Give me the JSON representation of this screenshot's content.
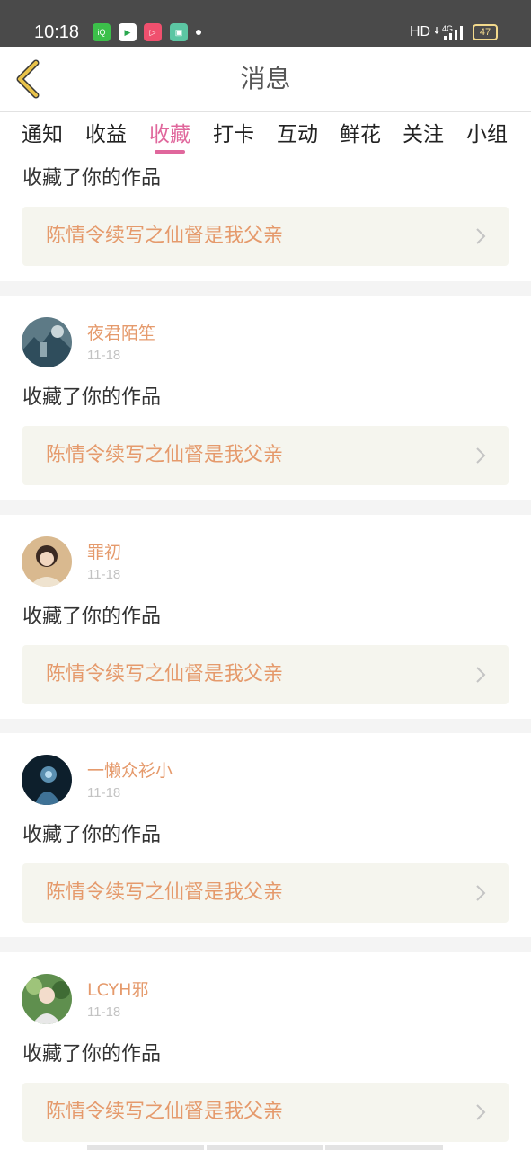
{
  "status_bar": {
    "time": "10:18",
    "network": "HD",
    "signal": "4G",
    "battery": "47"
  },
  "header": {
    "title": "消息",
    "back_icon": "chevron-left-icon"
  },
  "tabs": [
    {
      "label": "通知",
      "active": false
    },
    {
      "label": "收益",
      "active": false
    },
    {
      "label": "收藏",
      "active": true
    },
    {
      "label": "打卡",
      "active": false
    },
    {
      "label": "互动",
      "active": false
    },
    {
      "label": "鲜花",
      "active": false
    },
    {
      "label": "关注",
      "active": false
    },
    {
      "label": "小组",
      "active": false
    }
  ],
  "messages": [
    {
      "user": "",
      "date": "",
      "action": "收藏了你的作品",
      "work_title": "陈情令续写之仙督是我父亲"
    },
    {
      "user": "夜君陌笙",
      "date": "11-18",
      "action": "收藏了你的作品",
      "work_title": "陈情令续写之仙督是我父亲"
    },
    {
      "user": "罪初",
      "date": "11-18",
      "action": "收藏了你的作品",
      "work_title": "陈情令续写之仙督是我父亲"
    },
    {
      "user": "一懒众衫小",
      "date": "11-18",
      "action": "收藏了你的作品",
      "work_title": "陈情令续写之仙督是我父亲"
    },
    {
      "user": "LCYH邪",
      "date": "11-18",
      "action": "收藏了你的作品",
      "work_title": "陈情令续写之仙督是我父亲"
    }
  ],
  "colors": {
    "accent_pink": "#e0679c",
    "name_orange": "#e59a6c",
    "work_bg": "#f5f5ee",
    "back_arrow": "#e8c24a"
  }
}
